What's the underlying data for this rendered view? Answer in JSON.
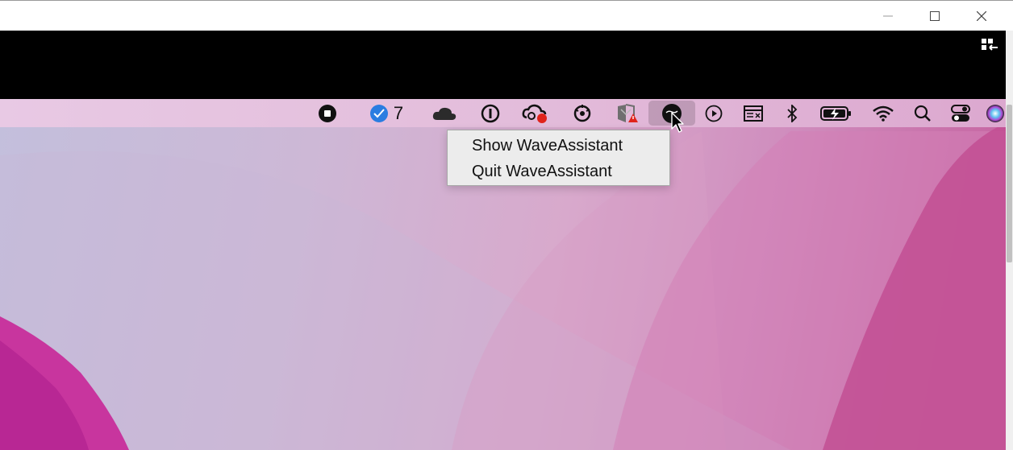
{
  "window": {
    "controls": [
      "minimize-icon",
      "maximize-icon",
      "close-icon"
    ]
  },
  "toolbar": {
    "fullscreen_icon": "fullscreen-icon"
  },
  "menubar": {
    "items": [
      {
        "icon": "stop-record-icon"
      },
      {
        "icon": "mail-icon",
        "count": "7"
      },
      {
        "icon": "cloud-icon"
      },
      {
        "icon": "password-manager-icon"
      },
      {
        "icon": "sync-cloud-icon"
      },
      {
        "icon": "network-icon"
      },
      {
        "icon": "antivirus-icon"
      },
      {
        "icon": "wave-assistant-icon",
        "active": true
      },
      {
        "icon": "play-icon"
      },
      {
        "icon": "window-icon"
      },
      {
        "icon": "bluetooth-icon"
      },
      {
        "icon": "battery-icon"
      },
      {
        "icon": "wifi-icon"
      },
      {
        "icon": "search-icon"
      },
      {
        "icon": "control-center-icon"
      },
      {
        "icon": "siri-icon"
      }
    ]
  },
  "context_menu": {
    "items": [
      {
        "label": "Show WaveAssistant"
      },
      {
        "label": "Quit WaveAssistant"
      }
    ]
  },
  "colors": {
    "menubar": "#e3bddb",
    "menu_bg": "#ececec",
    "accent_mail": "#2a7de1",
    "alert_red": "#e0231b"
  }
}
